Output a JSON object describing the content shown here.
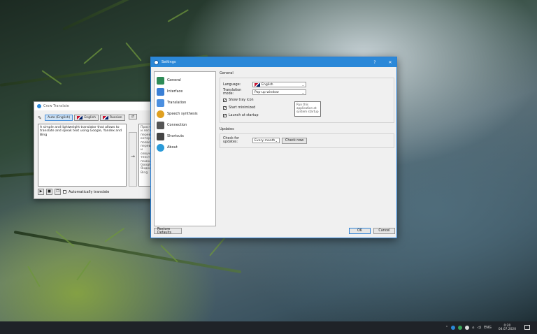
{
  "translator": {
    "title": "Crow Translate",
    "source_langs": [
      "Auto (English)",
      "English",
      "Russian"
    ],
    "swap_label": "⇄",
    "source_text": "A simple and lightweight translator that allows to translate and speak text using Google, Yandex and Bing",
    "target_text": "Простой и легкий переводчик, который позволяет переводить и озвучивать текст с помощью Google, Яндекс и Bing",
    "auto_translate_label": "Automatically translate"
  },
  "settings": {
    "title": "Settings",
    "help_label": "?",
    "close_label": "✕",
    "nav": [
      {
        "label": "General",
        "icon": "general-icon",
        "color": "#2e8b57"
      },
      {
        "label": "Interface",
        "icon": "interface-icon",
        "color": "#3a7fd5"
      },
      {
        "label": "Translation",
        "icon": "translation-icon",
        "color": "#4b8fe0"
      },
      {
        "label": "Speech synthesis",
        "icon": "speech-icon",
        "color": "#e0a020"
      },
      {
        "label": "Connection",
        "icon": "connection-icon",
        "color": "#555555"
      },
      {
        "label": "Shortcuts",
        "icon": "keyboard-icon",
        "color": "#444444"
      },
      {
        "label": "About",
        "icon": "info-icon",
        "color": "#2a9ad8"
      }
    ],
    "general": {
      "group_title": "General",
      "language_label": "Language:",
      "language_value": "English",
      "translation_mode_label": "Translation mode:",
      "translation_mode_value": "Pop-up window",
      "checkboxes": [
        {
          "label": "Show tray icon",
          "checked": true
        },
        {
          "label": "Start minimized",
          "checked": true
        },
        {
          "label": "Launch at startup",
          "checked": true
        }
      ]
    },
    "updates": {
      "group_title": "Updates",
      "check_label": "Check for updates:",
      "check_value": "Every month",
      "check_now_label": "Check now"
    },
    "tooltip": "Run this application at system startup",
    "restore_defaults_label": "Restore Defaults",
    "ok_label": "OK",
    "cancel_label": "Cancel"
  },
  "taskbar": {
    "lang": "ENG",
    "time": "0:20",
    "date": "04.07.2020"
  }
}
